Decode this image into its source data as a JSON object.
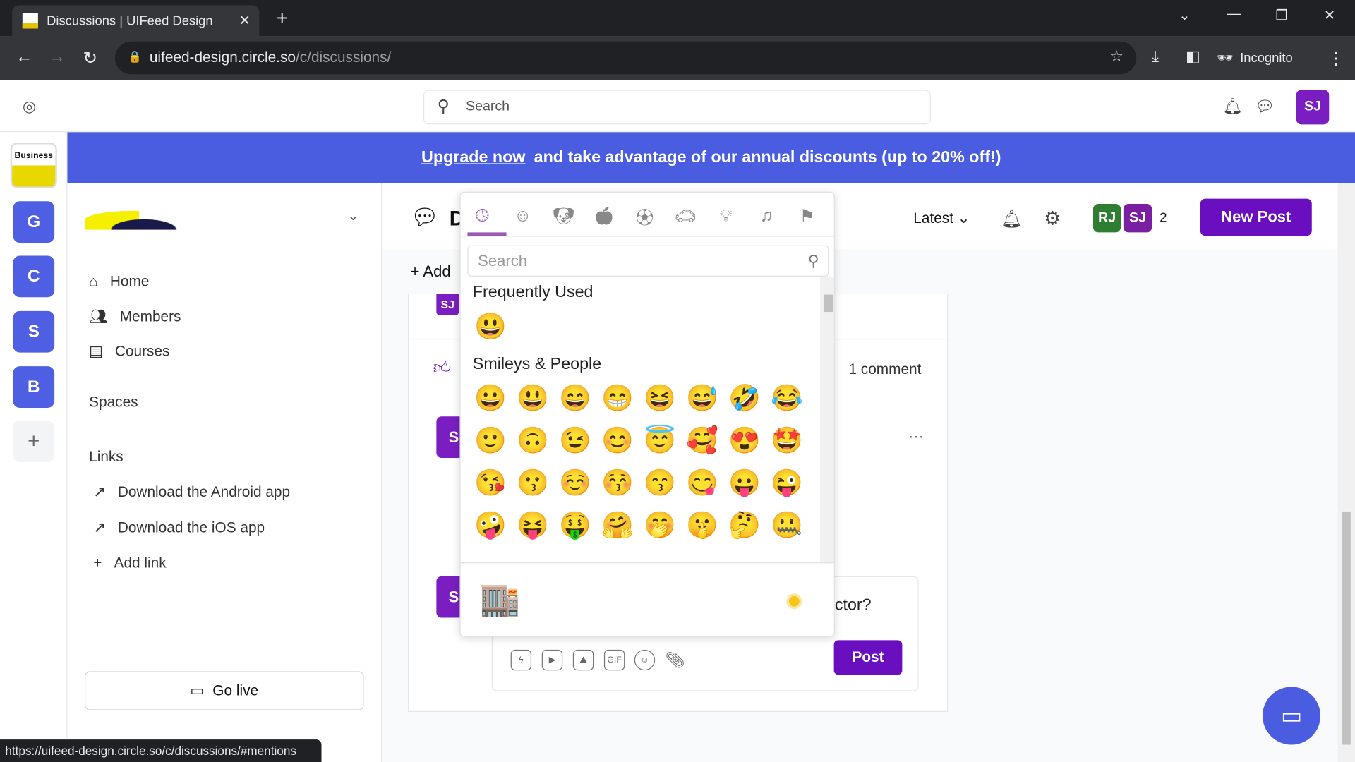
{
  "browser": {
    "tab_title": "Discussions | UIFeed Design",
    "url_host": "uifeed-design.circle.so",
    "url_path": "/c/discussions/",
    "profile": "Incognito",
    "status_url": "https://uifeed-design.circle.so/c/discussions/#mentions"
  },
  "header": {
    "search_placeholder": "Search",
    "user_initials": "SJ"
  },
  "rail": {
    "business_label": "Business",
    "communities": [
      "G",
      "C",
      "S",
      "B"
    ],
    "add": "+"
  },
  "banner": {
    "link": "Upgrade now",
    "text": "and take advantage of our annual discounts (up to 20% off!)"
  },
  "sidebar": {
    "nav": [
      {
        "label": "Home",
        "icon": "home-icon"
      },
      {
        "label": "Members",
        "icon": "members-icon"
      },
      {
        "label": "Courses",
        "icon": "courses-icon"
      }
    ],
    "spaces_heading": "Spaces",
    "links_heading": "Links",
    "links": [
      "Download the Android app",
      "Download the iOS app"
    ],
    "add_link": "Add link",
    "go_live": "Go live"
  },
  "main": {
    "title_partial": "D",
    "sort": "Latest",
    "member_avatars": [
      {
        "initials": "RJ",
        "color": "#2e7d32"
      },
      {
        "initials": "SJ",
        "color": "#7b1fa2"
      }
    ],
    "member_count": "2",
    "new_post": "New Post",
    "add_partial": "Add"
  },
  "post": {
    "author_initials": "SJ",
    "comments": "1 comment",
    "comment_avatar": "S",
    "reply_avatar": "S",
    "reply_text_partial": "ctor?",
    "post_button": "Post",
    "toolbar_gif": "GIF"
  },
  "picker": {
    "categories": [
      "recent",
      "smileys",
      "animals",
      "food",
      "activity",
      "travel",
      "objects",
      "symbols",
      "flags"
    ],
    "search_placeholder": "Search",
    "frequently_used_title": "Frequently Used",
    "frequently_used": [
      "😃"
    ],
    "smileys_title": "Smileys & People",
    "smileys": [
      "😀",
      "😃",
      "😄",
      "😁",
      "😆",
      "😅",
      "🤣",
      "😂",
      "🙂",
      "🙃",
      "😉",
      "😊",
      "😇",
      "🥰",
      "😍",
      "🤩",
      "😘",
      "😗",
      "☺️",
      "😚",
      "😙",
      "😋",
      "😛",
      "😜",
      "🤪",
      "😝",
      "🤑",
      "🤗",
      "🤭",
      "🤫",
      "🤔",
      "🤐"
    ],
    "preview": "🏬",
    "accent": "#9b59b6"
  },
  "colors": {
    "brand": "#4a5de0",
    "purple": "#6a0fbf"
  }
}
